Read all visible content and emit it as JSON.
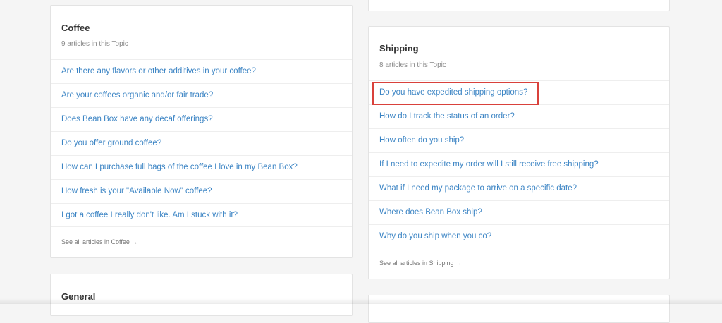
{
  "coffee": {
    "title": "Coffee",
    "count_text": "9 articles in this Topic",
    "articles": [
      "Are there any flavors or other additives in your coffee?",
      "Are your coffees organic and/or fair trade?",
      "Does Bean Box have any decaf offerings?",
      "Do you offer ground coffee?",
      "How can I purchase full bags of the coffee I love in my Bean Box?",
      "How fresh is your \"Available Now\" coffee?",
      "I got a coffee I really don't like. Am I stuck with it?"
    ],
    "see_all": "See all articles in Coffee →"
  },
  "shipping": {
    "title": "Shipping",
    "count_text": "8 articles in this Topic",
    "articles": [
      "Do you have expedited shipping options?",
      "How do I track the status of an order?",
      "How often do you ship?",
      "If I need to expedite my order will I still receive free shipping?",
      "What if I need my package to arrive on a specific date?",
      "Where does Bean Box ship?",
      "Why do you ship when you co?"
    ],
    "see_all": "See all articles in Shipping →"
  },
  "general": {
    "title": "General"
  },
  "colors": {
    "link": "#3b84c4",
    "highlight": "#d9413b",
    "title": "#333333",
    "muted": "#888888"
  }
}
